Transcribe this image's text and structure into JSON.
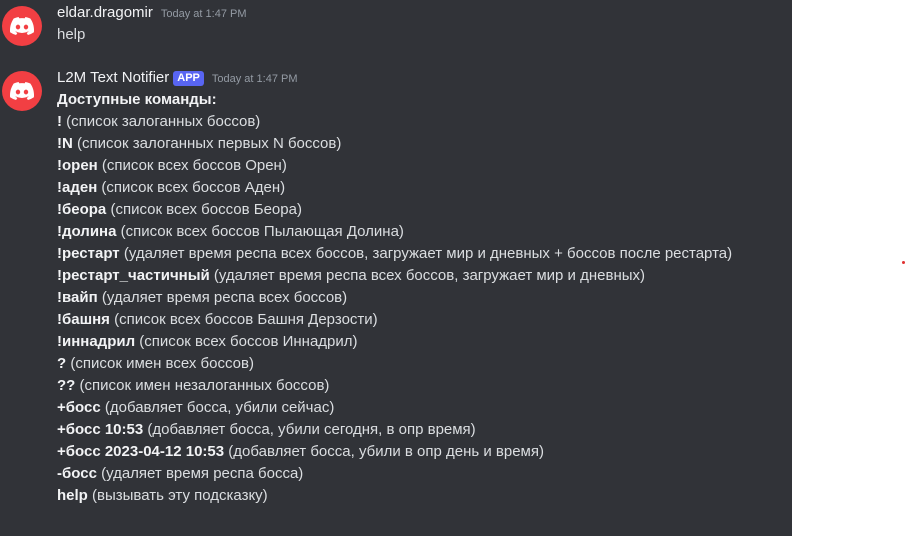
{
  "messages": [
    {
      "author": "eldar.dragomir",
      "timestamp": "Today at 1:47 PM",
      "text": "help"
    },
    {
      "author": "L2M Text Notifier",
      "badge": "APP",
      "timestamp": "Today at 1:47 PM",
      "heading": "Доступные команды:",
      "lines": [
        {
          "cmd": "!",
          "desc": " (список залоганных боссов)"
        },
        {
          "cmd": "!N",
          "desc": " (список залоганных первых N боссов)"
        },
        {
          "cmd": "!орен",
          "desc": " (список всех боссов Орен)"
        },
        {
          "cmd": "!аден",
          "desc": " (список всех боссов Аден)"
        },
        {
          "cmd": "!беора",
          "desc": " (список всех боссов Беора)"
        },
        {
          "cmd": "!долина",
          "desc": " (список всех боссов Пылающая Долина)"
        },
        {
          "cmd": "!рестарт",
          "desc": " (удаляет время респа всех боссов, загружает мир и дневных + боссов после рестарта)"
        },
        {
          "cmd": "!рестарт_частичный",
          "desc": " (удаляет время респа всех боссов, загружает мир и дневных)"
        },
        {
          "cmd": "!вайп",
          "desc": " (удаляет время респа всех боссов)"
        },
        {
          "cmd": "!башня",
          "desc": " (список всех боссов Башня Дерзости)"
        },
        {
          "cmd": "!иннадрил",
          "desc": " (список всех боссов Иннадрил)"
        },
        {
          "cmd": "?",
          "desc": " (список имен всех боссов)"
        },
        {
          "cmd": "??",
          "desc": " (список имен незалоганных боссов)"
        },
        {
          "cmd": "+босс",
          "desc": " (добавляет босса, убили сейчас)"
        },
        {
          "cmd": "+босс 10:53",
          "desc": " (добавляет босса, убили сегодня, в опр время)"
        },
        {
          "cmd": "+босс 2023-04-12 10:53",
          "desc": " (добавляет босса, убили в опр день и время)"
        },
        {
          "cmd": "-босс",
          "desc": " (удаляет время респа босса)"
        },
        {
          "cmd": "help",
          "desc": " (вызывать эту подсказку)"
        }
      ]
    }
  ],
  "icons": {
    "avatar": "discord-logo-icon"
  },
  "colors": {
    "background": "#313338",
    "avatar": "#f23f43",
    "badge": "#5865f2"
  }
}
